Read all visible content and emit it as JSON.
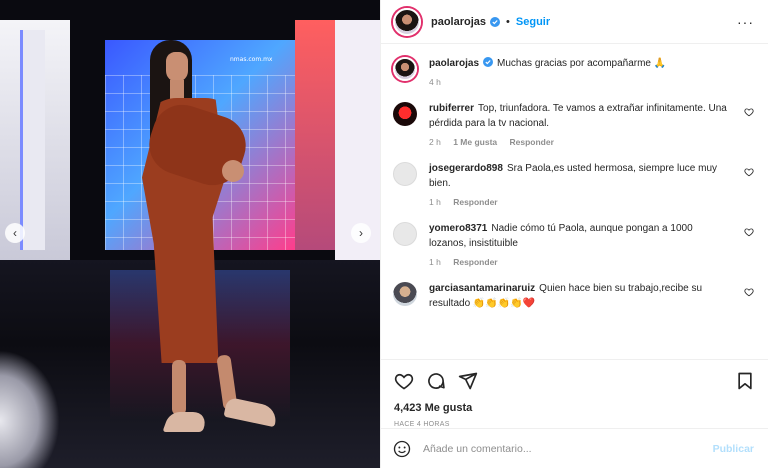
{
  "post": {
    "username": "paolarojas",
    "follow_label": "Seguir",
    "dot": "•",
    "more_label": "···",
    "caption_user": "paolarojas",
    "caption_text": "Muchas gracias por acompañarme 🙏",
    "caption_time": "4 h",
    "screen_text": "nmas.com.mx"
  },
  "comments": [
    {
      "user": "rubiferrer",
      "text": "Top, triunfadora. Te vamos a extrañar infinitamente. Una pérdida para la tv nacional.",
      "time": "2 h",
      "likes": "1 Me gusta",
      "reply": "Responder"
    },
    {
      "user": "josegerardo898",
      "text": "Sra Paola,es usted hermosa, siempre luce muy bien.",
      "time": "1 h",
      "reply": "Responder"
    },
    {
      "user": "yomero8371",
      "text": "Nadie cómo tú Paola, aunque pongan a 1000 lozanos, insistituible",
      "time": "1 h",
      "reply": "Responder"
    },
    {
      "user": "garciasantamarinaruiz",
      "text": "Quien hace bien su trabajo,recibe su resultado 👏👏👏👏❤️",
      "time": "",
      "reply": ""
    }
  ],
  "stats": {
    "likes_label": "4,423 Me gusta",
    "post_time": "HACE 4 HORAS"
  },
  "composer": {
    "placeholder": "Añade un comentario...",
    "publish_label": "Publicar"
  },
  "colors": {
    "accent": "#0095f6",
    "publish_disabled": "#b2dffc",
    "verified": "#3897f0"
  },
  "icons": {
    "carousel_prev": "‹",
    "carousel_next": "›"
  }
}
